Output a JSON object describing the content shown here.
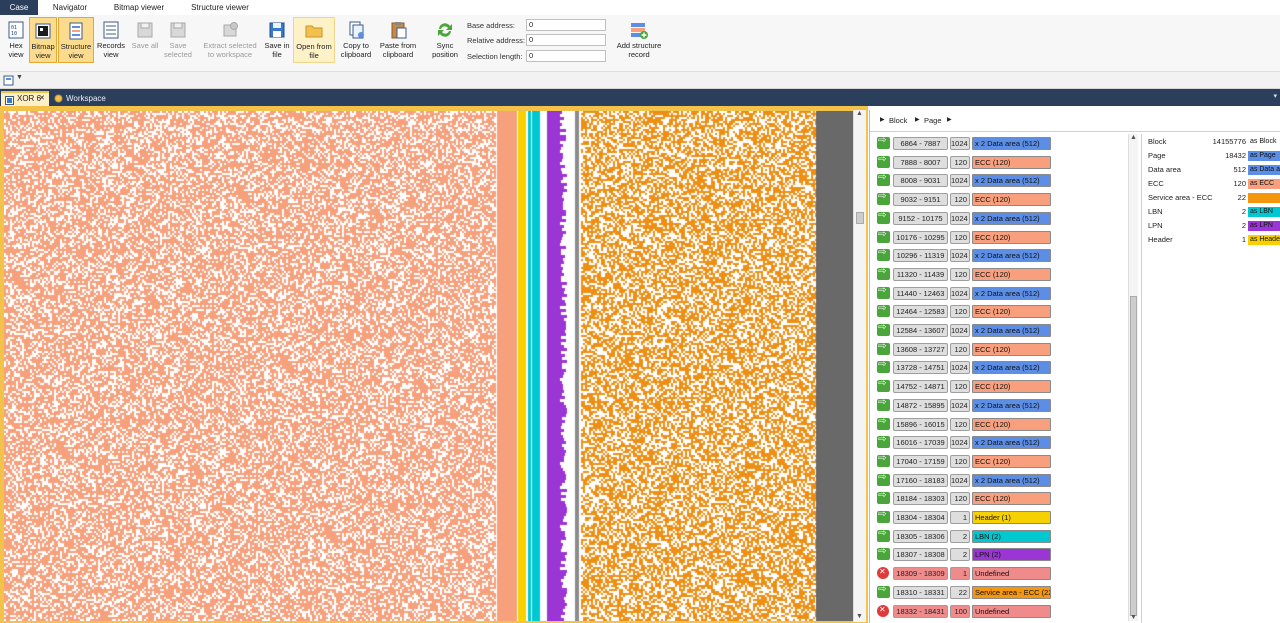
{
  "ribbon_tabs": [
    "Case",
    "Navigator",
    "Bitmap viewer",
    "Structure viewer"
  ],
  "ribbon": {
    "buttons": [
      {
        "id": "hex-view",
        "label": "Hex view",
        "icon": "hex-view-icon"
      },
      {
        "id": "bitmap-view",
        "label": "Bitmap view",
        "icon": "bitmap-view-icon"
      },
      {
        "id": "structure-view",
        "label": "Structure view",
        "icon": "structure-view-icon"
      },
      {
        "id": "records-view",
        "label": "Records view",
        "icon": "records-view-icon"
      },
      {
        "id": "save-all",
        "label": "Save all",
        "icon": "save-all-icon"
      },
      {
        "id": "save-selected",
        "label": "Save selected",
        "icon": "save-selected-icon"
      },
      {
        "id": "extract-selected",
        "label": "Extract selected to workspace",
        "icon": "extract-icon"
      },
      {
        "id": "save-in-file",
        "label": "Save in file",
        "icon": "save-file-icon"
      },
      {
        "id": "open-from-file",
        "label": "Open from file",
        "icon": "folder-icon"
      },
      {
        "id": "copy-clipboard",
        "label": "Copy to clipboard",
        "icon": "copy-icon"
      },
      {
        "id": "paste-clipboard",
        "label": "Paste from clipboard",
        "icon": "paste-icon"
      },
      {
        "id": "sync-position",
        "label": "Sync position",
        "icon": "sync-icon"
      },
      {
        "id": "add-structure-record",
        "label": "Add structure record",
        "icon": "add-record-icon"
      }
    ],
    "fields": [
      {
        "label": "Base address:",
        "value": "0"
      },
      {
        "label": "Relative address:",
        "value": "0"
      },
      {
        "label": "Selection length:",
        "value": "0"
      }
    ]
  },
  "doc_tabs": [
    {
      "label": "XOR 6",
      "close": "✕"
    },
    {
      "label": "Workspace"
    }
  ],
  "breadcrumb": [
    "Block",
    "Page"
  ],
  "colors": {
    "data": "#5c8ee6",
    "ecc": "#f8a07d",
    "header": "#f7d000",
    "lbn": "#00c8d0",
    "lpn": "#9b35d6",
    "undefined": "#f08b8b",
    "service": "#f5960f",
    "bitmap_salmon": "#f6a07c",
    "bitmap_orange": "#ee8f14",
    "bitmap_gray": "#696969"
  },
  "records": [
    {
      "range": "6864 - 7887",
      "size": "1024",
      "label": "x 2 Data area (512)",
      "type": "data",
      "status": "ok"
    },
    {
      "range": "7888 - 8007",
      "size": "120",
      "label": "ECC (120)",
      "type": "ecc",
      "status": "ok"
    },
    {
      "range": "8008 - 9031",
      "size": "1024",
      "label": "x 2 Data area (512)",
      "type": "data",
      "status": "ok"
    },
    {
      "range": "9032 - 9151",
      "size": "120",
      "label": "ECC (120)",
      "type": "ecc",
      "status": "ok"
    },
    {
      "range": "9152 - 10175",
      "size": "1024",
      "label": "x 2 Data area (512)",
      "type": "data",
      "status": "ok"
    },
    {
      "range": "10176 - 10295",
      "size": "120",
      "label": "ECC (120)",
      "type": "ecc",
      "status": "ok"
    },
    {
      "range": "10296 - 11319",
      "size": "1024",
      "label": "x 2 Data area (512)",
      "type": "data",
      "status": "ok"
    },
    {
      "range": "11320 - 11439",
      "size": "120",
      "label": "ECC (120)",
      "type": "ecc",
      "status": "ok"
    },
    {
      "range": "11440 - 12463",
      "size": "1024",
      "label": "x 2 Data area (512)",
      "type": "data",
      "status": "ok"
    },
    {
      "range": "12464 - 12583",
      "size": "120",
      "label": "ECC (120)",
      "type": "ecc",
      "status": "ok"
    },
    {
      "range": "12584 - 13607",
      "size": "1024",
      "label": "x 2 Data area (512)",
      "type": "data",
      "status": "ok"
    },
    {
      "range": "13608 - 13727",
      "size": "120",
      "label": "ECC (120)",
      "type": "ecc",
      "status": "ok"
    },
    {
      "range": "13728 - 14751",
      "size": "1024",
      "label": "x 2 Data area (512)",
      "type": "data",
      "status": "ok"
    },
    {
      "range": "14752 - 14871",
      "size": "120",
      "label": "ECC (120)",
      "type": "ecc",
      "status": "ok"
    },
    {
      "range": "14872 - 15895",
      "size": "1024",
      "label": "x 2 Data area (512)",
      "type": "data",
      "status": "ok"
    },
    {
      "range": "15896 - 16015",
      "size": "120",
      "label": "ECC (120)",
      "type": "ecc",
      "status": "ok"
    },
    {
      "range": "16016 - 17039",
      "size": "1024",
      "label": "x 2 Data area (512)",
      "type": "data",
      "status": "ok"
    },
    {
      "range": "17040 - 17159",
      "size": "120",
      "label": "ECC (120)",
      "type": "ecc",
      "status": "ok"
    },
    {
      "range": "17160 - 18183",
      "size": "1024",
      "label": "x 2 Data area (512)",
      "type": "data",
      "status": "ok"
    },
    {
      "range": "18184 - 18303",
      "size": "120",
      "label": "ECC (120)",
      "type": "ecc",
      "status": "ok"
    },
    {
      "range": "18304 - 18304",
      "size": "1",
      "label": "Header (1)",
      "type": "header",
      "status": "ok"
    },
    {
      "range": "18305 - 18306",
      "size": "2",
      "label": "LBN (2)",
      "type": "lbn",
      "status": "ok"
    },
    {
      "range": "18307 - 18308",
      "size": "2",
      "label": "LPN (2)",
      "type": "lpn",
      "status": "ok"
    },
    {
      "range": "18309 - 18309",
      "size": "1",
      "label": "Undefined",
      "type": "undefined",
      "status": "err"
    },
    {
      "range": "18310 - 18331",
      "size": "22",
      "label": "Service area - ECC (22)",
      "type": "service",
      "status": "ok"
    },
    {
      "range": "18332 - 18431",
      "size": "100",
      "label": "Undefined",
      "type": "undefined",
      "status": "err"
    }
  ],
  "properties": [
    {
      "name": "Block",
      "value": "14155776",
      "as": "as Block",
      "type": "none"
    },
    {
      "name": "Page",
      "value": "18432",
      "as": "as Page",
      "type": "data"
    },
    {
      "name": "Data area",
      "value": "512",
      "as": "as Data area",
      "type": "data"
    },
    {
      "name": "ECC",
      "value": "120",
      "as": "as ECC",
      "type": "ecc"
    },
    {
      "name": "Service area - ECC",
      "value": "22",
      "as": "",
      "type": "service"
    },
    {
      "name": "LBN",
      "value": "2",
      "as": "as LBN",
      "type": "lbn"
    },
    {
      "name": "LPN",
      "value": "2",
      "as": "as LPN",
      "type": "lpn"
    },
    {
      "name": "Header",
      "value": "1",
      "as": "as Header",
      "type": "header"
    }
  ]
}
